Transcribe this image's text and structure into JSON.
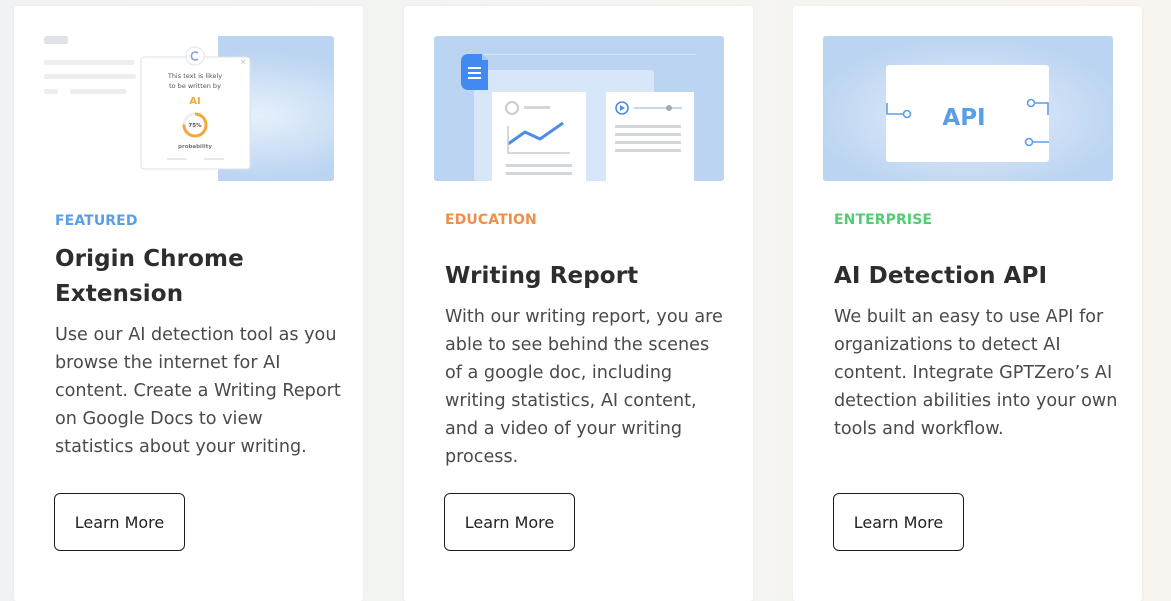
{
  "cards": [
    {
      "tag": "FEATURED",
      "title": "Origin Chrome Extension",
      "description": "Use our AI detection tool as you browse the internet for AI content. Create a Writing Report on Google Docs to view statistics about your writing.",
      "button_label": "Learn More",
      "illustration": {
        "popup_line1": "This text is likely",
        "popup_line2": "to be written by",
        "popup_highlight": "AI",
        "gauge_value": "75%",
        "gauge_label": "probability",
        "close_glyph": "×"
      }
    },
    {
      "tag": "EDUCATION",
      "title": "Writing Report",
      "description": "With our writing report, you are able to see behind the scenes of a google doc, including writing statistics, AI content, and a video of your writing process.",
      "button_label": "Learn More"
    },
    {
      "tag": "ENTERPRISE",
      "title": "AI Detection API",
      "description": "We built an easy to use API for organizations to detect AI content. Integrate GPTZero’s AI detection abilities into your own tools and workflow.",
      "button_label": "Learn More",
      "illustration": {
        "panel_label": "API"
      }
    }
  ],
  "colors": {
    "featured": "#5a9ee8",
    "education": "#ee9049",
    "enterprise": "#4fce72",
    "illustration_bg": "#bad4f1"
  }
}
